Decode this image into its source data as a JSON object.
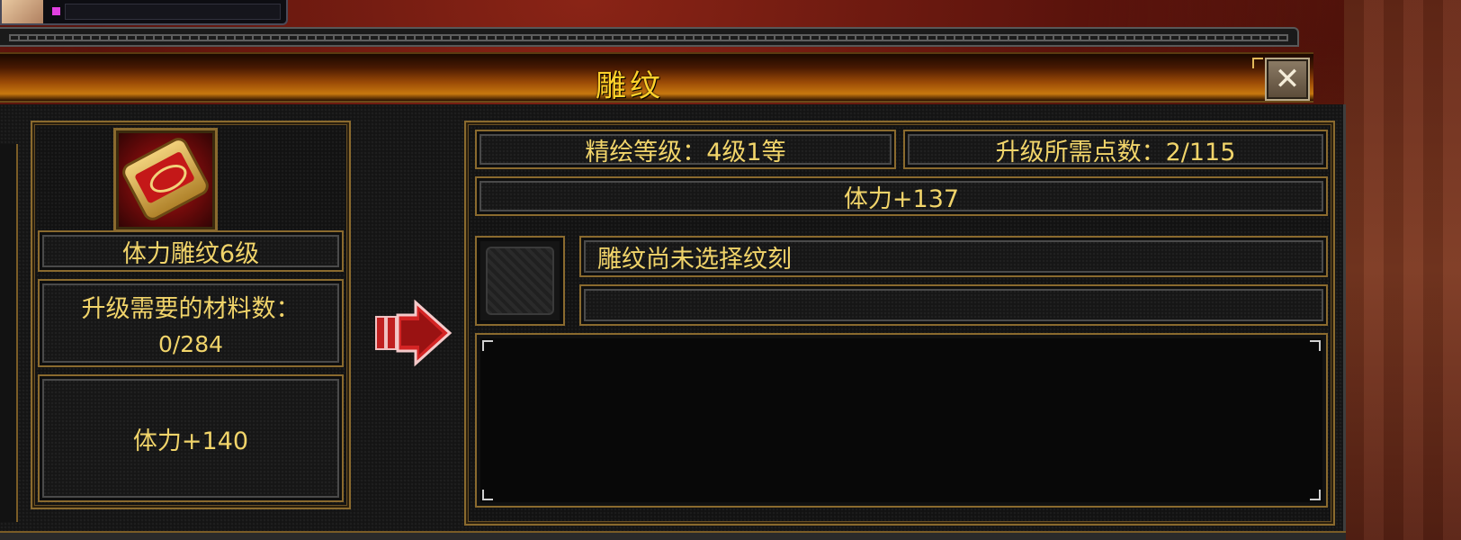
{
  "window": {
    "title": "雕纹",
    "close_label": "✕"
  },
  "left_panel": {
    "item_name": "体力雕纹6级",
    "materials_label": "升级需要的材料数：",
    "materials_value": "0/284",
    "next_bonus": "体力+140"
  },
  "right_panel": {
    "refine_level": "精绘等级：4级1等",
    "upgrade_points": "升级所需点数：2/115",
    "current_bonus": "体力+137",
    "engrave_status": "雕纹尚未选择纹刻",
    "engrave_detail": ""
  },
  "icons": {
    "item": "carving-scroll-icon",
    "arrow": "right-arrow-icon",
    "empty_slot": "empty-engrave-slot-icon"
  },
  "colors": {
    "text_gold": "#f1d46a",
    "title_gold": "#ffd12a",
    "frame_gold": "#8a6a2e"
  }
}
